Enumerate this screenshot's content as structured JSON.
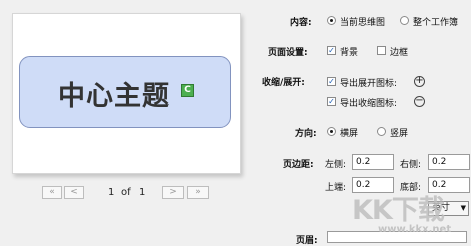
{
  "preview": {
    "topic_text": "中心主题",
    "topic_badge": "C"
  },
  "pager": {
    "first": "«",
    "prev": "<",
    "current": "1",
    "of": "of",
    "total": "1",
    "next": ">",
    "last": "»"
  },
  "settings": {
    "content_label": "内容:",
    "content_options": [
      "当前思维图",
      "整个工作簿"
    ],
    "content_selected": 0,
    "page_label": "页面设置:",
    "page_background": "背景",
    "page_border": "边框",
    "collapse_label": "收缩/展开:",
    "export_expand": "导出展开图标:",
    "export_collapse": "导出收缩图标:",
    "direction_label": "方向:",
    "direction_options": [
      "横屏",
      "竖屏"
    ],
    "direction_selected": 0,
    "margins_label": "页边距:",
    "left_label": "左侧:",
    "left_value": "0.2",
    "right_label": "右侧:",
    "right_value": "0.2",
    "top_label": "上端:",
    "top_value": "0.2",
    "bottom_label": "底部:",
    "bottom_value": "0.2",
    "unit": "英寸",
    "footer_label": "页眉:"
  },
  "watermark": {
    "logo": "KK下载",
    "url": "www.kkx.net"
  }
}
